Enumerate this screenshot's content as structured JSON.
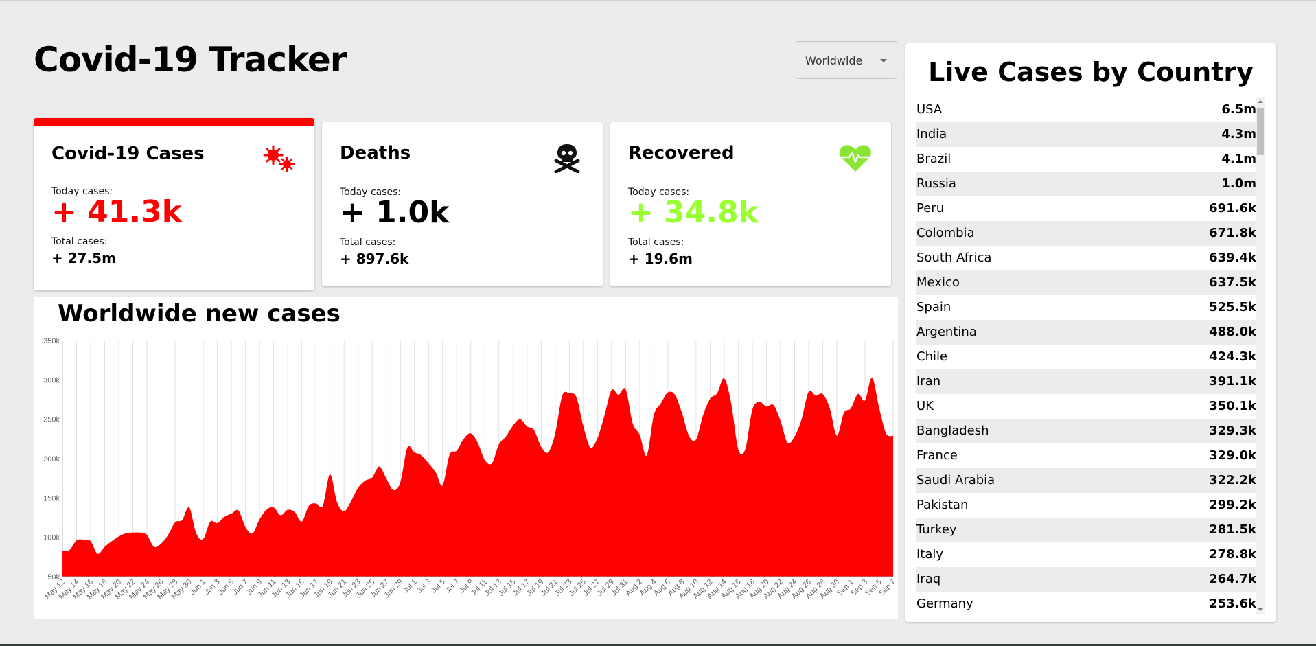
{
  "app": {
    "title": "Covid-19 Tracker"
  },
  "country_select": {
    "value": "Worldwide"
  },
  "stats": [
    {
      "title": "Covid-19 Cases",
      "icon": "virus-icon",
      "today_label": "Today cases:",
      "today": "+ 41.3k",
      "total_label": "Total cases:",
      "total": "+ 27.5m",
      "color": "#ff0000",
      "selected": true
    },
    {
      "title": "Deaths",
      "icon": "skull-crossbones-icon",
      "today_label": "Today cases:",
      "today": "+ 1.0k",
      "total_label": "Total cases:",
      "total": "+ 897.6k",
      "color": "#000000",
      "selected": false
    },
    {
      "title": "Recovered",
      "icon": "heartbeat-icon",
      "today_label": "Today cases:",
      "today": "+ 34.8k",
      "total_label": "Total cases:",
      "total": "+ 19.6m",
      "color": "#99ff33",
      "selected": false
    }
  ],
  "table": {
    "title": "Live Cases by Country",
    "rows": [
      {
        "country": "USA",
        "cases": "6.5m"
      },
      {
        "country": "India",
        "cases": "4.3m"
      },
      {
        "country": "Brazil",
        "cases": "4.1m"
      },
      {
        "country": "Russia",
        "cases": "1.0m"
      },
      {
        "country": "Peru",
        "cases": "691.6k"
      },
      {
        "country": "Colombia",
        "cases": "671.8k"
      },
      {
        "country": "South Africa",
        "cases": "639.4k"
      },
      {
        "country": "Mexico",
        "cases": "637.5k"
      },
      {
        "country": "Spain",
        "cases": "525.5k"
      },
      {
        "country": "Argentina",
        "cases": "488.0k"
      },
      {
        "country": "Chile",
        "cases": "424.3k"
      },
      {
        "country": "Iran",
        "cases": "391.1k"
      },
      {
        "country": "UK",
        "cases": "350.1k"
      },
      {
        "country": "Bangladesh",
        "cases": "329.3k"
      },
      {
        "country": "France",
        "cases": "329.0k"
      },
      {
        "country": "Saudi Arabia",
        "cases": "322.2k"
      },
      {
        "country": "Pakistan",
        "cases": "299.2k"
      },
      {
        "country": "Turkey",
        "cases": "281.5k"
      },
      {
        "country": "Italy",
        "cases": "278.8k"
      },
      {
        "country": "Iraq",
        "cases": "264.7k"
      },
      {
        "country": "Germany",
        "cases": "253.6k"
      }
    ]
  },
  "chart_data": {
    "type": "area",
    "title": "Worldwide new cases",
    "color": "#ff0000",
    "ylim": [
      50000,
      350000
    ],
    "yticks": [
      "50k",
      "100k",
      "150k",
      "200k",
      "250k",
      "300k",
      "350k"
    ],
    "ytick_values": [
      50000,
      100000,
      150000,
      200000,
      250000,
      300000,
      350000
    ],
    "x_start": "May 12",
    "xticks": [
      "May 12",
      "May 14",
      "May 16",
      "May 18",
      "May 20",
      "May 22",
      "May 24",
      "May 26",
      "May 28",
      "May 30",
      "Jun 1",
      "Jun 3",
      "Jun 5",
      "Jun 7",
      "Jun 9",
      "Jun 11",
      "Jun 13",
      "Jun 15",
      "Jun 17",
      "Jun 19",
      "Jun 21",
      "Jun 23",
      "Jun 25",
      "Jun 27",
      "Jun 29",
      "Jul 1",
      "Jul 3",
      "Jul 5",
      "Jul 7",
      "Jul 9",
      "Jul 11",
      "Jul 13",
      "Jul 15",
      "Jul 17",
      "Jul 19",
      "Jul 21",
      "Jul 23",
      "Jul 25",
      "Jul 27",
      "Jul 29",
      "Jul 31",
      "Aug 2",
      "Aug 4",
      "Aug 6",
      "Aug 8",
      "Aug 10",
      "Aug 12",
      "Aug 14",
      "Aug 16",
      "Aug 18",
      "Aug 20",
      "Aug 22",
      "Aug 24",
      "Aug 26",
      "Aug 28",
      "Aug 30",
      "Sep 1",
      "Sep 3",
      "Sep 5",
      "Sep 7"
    ],
    "values": [
      83000,
      84000,
      96000,
      97000,
      95000,
      79000,
      88000,
      95000,
      101000,
      105000,
      106000,
      106000,
      103000,
      88000,
      92000,
      103000,
      119000,
      122000,
      138000,
      105000,
      98000,
      120000,
      118000,
      126000,
      130000,
      134000,
      113000,
      105000,
      123000,
      135000,
      138000,
      128000,
      135000,
      132000,
      120000,
      140000,
      143000,
      140000,
      180000,
      145000,
      133000,
      146000,
      163000,
      172000,
      176000,
      190000,
      175000,
      160000,
      170000,
      214000,
      208000,
      204000,
      194000,
      183000,
      166000,
      205000,
      210000,
      225000,
      232000,
      220000,
      198000,
      194000,
      218000,
      228000,
      242000,
      250000,
      241000,
      236000,
      215000,
      208000,
      232000,
      280000,
      283000,
      278000,
      241000,
      214000,
      226000,
      255000,
      287000,
      281000,
      288000,
      245000,
      230000,
      204000,
      255000,
      270000,
      284000,
      281000,
      258000,
      229000,
      224000,
      255000,
      276000,
      283000,
      302000,
      270000,
      212000,
      212000,
      262000,
      272000,
      266000,
      268000,
      248000,
      220000,
      228000,
      250000,
      285000,
      280000,
      282000,
      264000,
      229000,
      258000,
      264000,
      282000,
      274000,
      303000,
      265000,
      232000,
      229000
    ]
  }
}
